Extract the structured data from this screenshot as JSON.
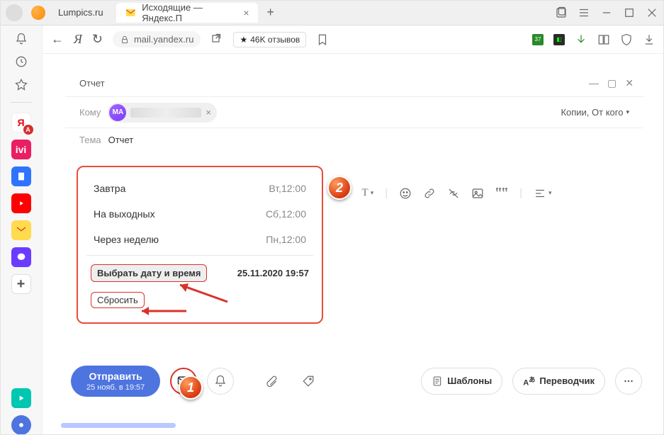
{
  "browser": {
    "tabs": [
      {
        "title": "Lumpics.ru"
      },
      {
        "title": "Исходящие — Яндекс.П"
      }
    ],
    "url": "mail.yandex.ru",
    "reviews_label": "46K отзывов"
  },
  "compose": {
    "window_title": "Отчет",
    "to_label": "Кому",
    "chip_initials": "MA",
    "copies_label": "Копии, От кого",
    "subject_label": "Тема",
    "subject_value": "Отчет"
  },
  "schedule_popup": {
    "items": [
      {
        "label": "Завтра",
        "time": "Вт,12:00"
      },
      {
        "label": "На выходных",
        "time": "Сб,12:00"
      },
      {
        "label": "Через неделю",
        "time": "Пн,12:00"
      }
    ],
    "select_label": "Выбрать дату и время",
    "select_value": "25.11.2020 19:57",
    "reset_label": "Сбросить"
  },
  "actions": {
    "send_main": "Отправить",
    "send_sub": "25 нояб. в 19:57",
    "templates_label": "Шаблоны",
    "translator_label": "Переводчик"
  },
  "callouts": {
    "one": "1",
    "two": "2"
  },
  "sidebar_tiles": {
    "ya_letter": "Я",
    "calendar_num": "37"
  }
}
